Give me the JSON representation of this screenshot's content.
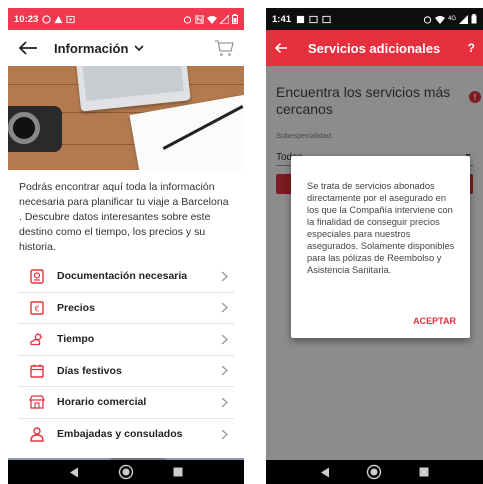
{
  "left": {
    "status_bar": {
      "time": "10:23",
      "icons": [
        "whatsapp-icon",
        "warning-icon",
        "gallery-icon"
      ],
      "right_icons": [
        "alarm-icon",
        "nfc-icon",
        "wifi-icon",
        "signal-icon",
        "battery-icon"
      ],
      "background": "#f0384f"
    },
    "app_bar": {
      "title": "Información"
    },
    "intro_text": "Podrás encontrar aquí  toda la información necesaria para planificar tu viaje a Barcelona . Descubre datos interesantes sobre este destino como el tiempo, los precios y su historia.",
    "menu": [
      {
        "label": "Documentación necesaria",
        "icon": "passport-icon"
      },
      {
        "label": "Precios",
        "icon": "euro-card-icon"
      },
      {
        "label": "Tiempo",
        "icon": "weather-icon"
      },
      {
        "label": "Días festivos",
        "icon": "calendar-icon"
      },
      {
        "label": "Horario comercial",
        "icon": "shop-icon"
      },
      {
        "label": "Embajadas y consulados",
        "icon": "person-icon"
      }
    ],
    "accent": "#e6303e"
  },
  "right": {
    "status_bar": {
      "time": "1:41",
      "network": "4G"
    },
    "app_bar": {
      "title": "Servicios adicionales",
      "help": "?"
    },
    "heading": "Encuentra los servicios más cercanos",
    "field_label": "Subespecialidad",
    "field_value": "Todas",
    "dialog": {
      "text": "Se trata de servicios abonados directamente por el asegurado en los que la Compañía interviene con la finalidad de conseguir precios especiales para nuestros asegurados. Solamente disponibles para las pólizas de Reembolso y Asistencia Sanitaria.",
      "action": "ACEPTAR"
    }
  }
}
